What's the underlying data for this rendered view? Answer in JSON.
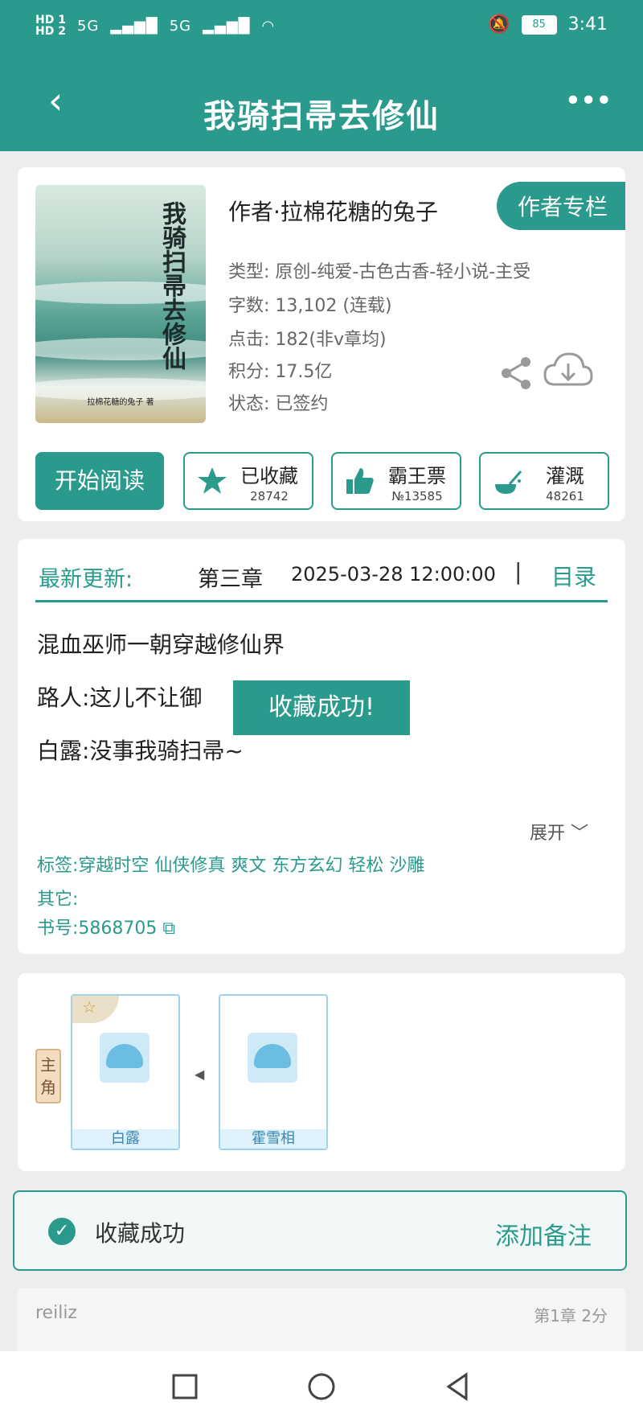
{
  "status_bar": {
    "hd1": "HD 1",
    "hd2": "HD 2",
    "net1": "5G",
    "net2": "5G",
    "battery": "85",
    "time": "3:41"
  },
  "header": {
    "title": "我骑扫帚去修仙",
    "back_icon": "back-chevron",
    "more_icon": "more-dots"
  },
  "book": {
    "cover_title": "我骑扫帚去修仙",
    "cover_author": "拉棉花糖的兔子 著",
    "author_line": "作者·拉棉花糖的兔子",
    "author_column_btn": "作者专栏",
    "type": "类型: 原创-纯爱-古色古香-轻小说-主受",
    "words": "字数: 13,102 (连载)",
    "clicks": "点击: 182(非v章均)",
    "score": "积分: 17.5亿",
    "state": "状态: 已签约"
  },
  "actions": {
    "read": "开始阅读",
    "fav_label": "已收藏",
    "fav_count": "28742",
    "vote_label": "霸王票",
    "vote_count": "№13585",
    "water_label": "灌溉",
    "water_count": "48261"
  },
  "update": {
    "label": "最新更新:",
    "chapter": "第三章",
    "date": "2025-03-28 12:00:00",
    "separator": "|",
    "toc": "目录"
  },
  "intro": {
    "line1": "混血巫师一朝穿越修仙界",
    "line2": "路人:这儿不让御",
    "line3": "白露:没事我骑扫帚~",
    "toast": "收藏成功!",
    "expand": "展开"
  },
  "meta": {
    "tags": "标签:穿越时空 仙侠修真 爽文 东方玄幻 轻松 沙雕",
    "other": "其它:",
    "book_no": "书号:5868705"
  },
  "characters": {
    "role_tag": "主角",
    "items": [
      "白露",
      "霍雪相"
    ]
  },
  "success_bar": {
    "message": "收藏成功",
    "add_note": "添加备注"
  },
  "comment": {
    "user": "reiliz",
    "meta": "第1章  2分"
  },
  "colors": {
    "primary": "#2a9a8d"
  }
}
